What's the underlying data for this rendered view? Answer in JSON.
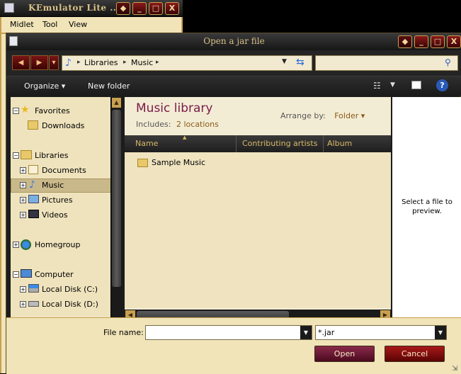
{
  "background_window": {
    "title": "KEmulator Lite ...",
    "menu": [
      "Midlet",
      "Tool",
      "View"
    ],
    "buttons": {
      "menu_btn": "◆",
      "minimize": "_",
      "maximize": "□",
      "close": "X"
    }
  },
  "dialog": {
    "title": "Open a jar file",
    "window_buttons": {
      "menu_btn": "◆",
      "minimize": "_",
      "maximize": "□",
      "close": "X"
    },
    "address": {
      "segments": [
        "Libraries",
        "Music"
      ],
      "separator": "▸"
    },
    "search": {
      "placeholder": ""
    },
    "toolbar": {
      "organize": "Organize",
      "new_folder": "New folder"
    },
    "nav_pane": {
      "favorites": {
        "label": "Favorites",
        "items": [
          {
            "label": "Downloads"
          }
        ]
      },
      "libraries": {
        "label": "Libraries",
        "items": [
          {
            "label": "Documents"
          },
          {
            "label": "Music"
          },
          {
            "label": "Pictures"
          },
          {
            "label": "Videos"
          }
        ]
      },
      "homegroup": {
        "label": "Homegroup"
      },
      "computer": {
        "label": "Computer",
        "items": [
          {
            "label": "Local Disk (C:)"
          },
          {
            "label": "Local Disk (D:)"
          }
        ]
      }
    },
    "content": {
      "title": "Music library",
      "includes_label": "Includes:",
      "includes_link": "2 locations",
      "arrange_label": "Arrange by:",
      "arrange_value": "Folder",
      "columns": [
        "Name",
        "Contributing artists",
        "Album"
      ],
      "files": [
        {
          "name": "Sample Music"
        }
      ]
    },
    "preview_text": "Select a file to preview.",
    "bottom": {
      "filename_label": "File name:",
      "filename_value": "",
      "filetype_value": "*.jar",
      "open_label": "Open",
      "cancel_label": "Cancel"
    }
  },
  "colors": {
    "accent_purple": "#7a1a4a",
    "gold": "#d8b868",
    "beige": "#f0e4b8"
  }
}
